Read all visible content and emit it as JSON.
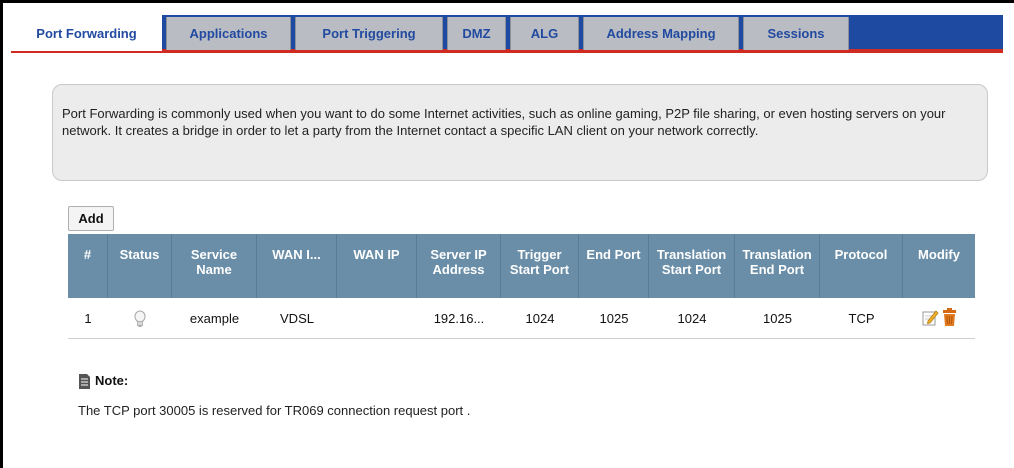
{
  "tabs": [
    {
      "label": "Port Forwarding",
      "active": true
    },
    {
      "label": "Applications",
      "active": false
    },
    {
      "label": "Port Triggering",
      "active": false
    },
    {
      "label": "DMZ",
      "active": false
    },
    {
      "label": "ALG",
      "active": false
    },
    {
      "label": "Address Mapping",
      "active": false
    },
    {
      "label": "Sessions",
      "active": false
    }
  ],
  "info": {
    "text": "Port Forwarding is commonly used when you want to do some Internet activities, such as online gaming, P2P file sharing, or even hosting servers on your network. It creates a bridge in order to let a party from the Internet contact a specific LAN client on your network correctly."
  },
  "toolbar": {
    "add_label": "Add"
  },
  "table": {
    "headers": [
      "#",
      "Status",
      "Service Name",
      "WAN I...",
      "WAN IP",
      "Server IP Address",
      "Trigger Start Port",
      "End Port",
      "Translation Start Port",
      "Translation End Port",
      "Protocol",
      "Modify"
    ],
    "rows": [
      {
        "index": "1",
        "status_icon": "lightbulb-icon",
        "service_name": "example",
        "wan_interface": "VDSL",
        "wan_ip": "",
        "server_ip": "192.16...",
        "trigger_start_port": "1024",
        "end_port": "1025",
        "translation_start_port": "1024",
        "translation_end_port": "1025",
        "protocol": "TCP",
        "modify_icons": [
          "edit-icon",
          "delete-icon"
        ]
      }
    ]
  },
  "note": {
    "title": "Note:",
    "text": "The TCP port 30005 is reserved for TR069 connection request port ."
  },
  "colors": {
    "tab_bar": "#1e4aa2",
    "tab_inactive": "#b9bcc3",
    "tab_text": "#214aa0",
    "accent_red": "#cf2b22",
    "table_header": "#6a8ea8",
    "info_bg": "#ececec"
  }
}
